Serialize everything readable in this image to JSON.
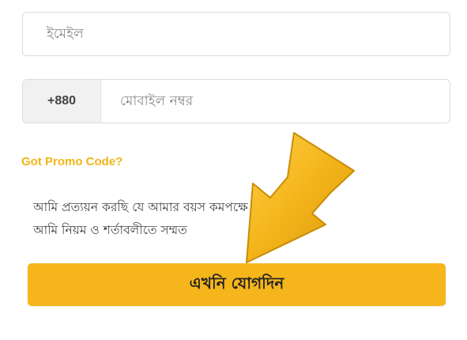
{
  "form": {
    "email_placeholder": "ইমেইল",
    "country_code": "+880",
    "phone_placeholder": "মোবাইল নম্বর",
    "promo_link": "Got Promo Code?",
    "consent_line1": "আমি প্রত্যয়ন করছি যে আমার বয়স কমপক্ষে ১৮বছর এবং",
    "consent_line2": "আমি নিয়ম ও শর্তাবলীতে সম্মত",
    "join_button": "এখনি যোগদিন"
  },
  "colors": {
    "accent": "#f5b51b",
    "promo_text": "#f0b51a",
    "pointer_arrow": "#f3b41a"
  },
  "icons": {
    "overlay": "pointer-arrow-icon"
  }
}
